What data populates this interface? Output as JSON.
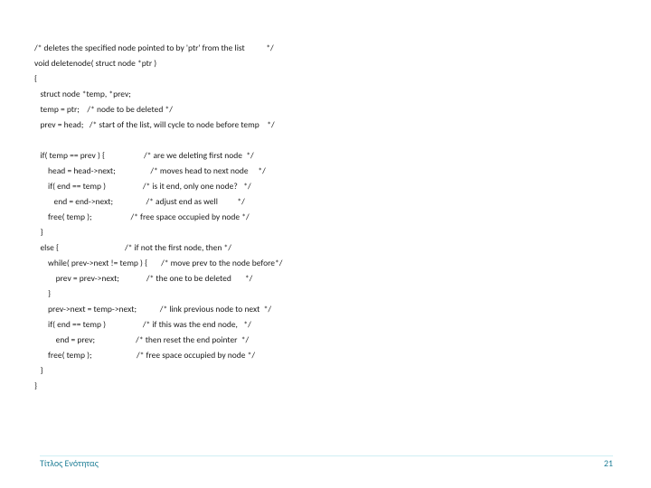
{
  "code": {
    "l1": "/* deletes the specified node pointed to by 'ptr' from the list           */",
    "l2": "void deletenode( struct node *ptr )",
    "l3": "{",
    "l4": "   struct node *temp, *prev;",
    "l5": "   temp = ptr;    /* node to be deleted */",
    "l6": "   prev = head;   /* start of the list, will cycle to node before temp    */",
    "l7": "",
    "l8": "   if( temp == prev ) {                    /* are we deleting first node  */",
    "l9": "       head = head->next;                  /* moves head to next node     */",
    "l10": "       if( end == temp )                   /* is it end, only one node?   */",
    "l11": "          end = end->next;                 /* adjust end as well          */",
    "l12": "       free( temp );                    /* free space occupied by node */",
    "l13": "   }",
    "l14": "   else {                                  /* if not the first node, then */",
    "l15": "       while( prev->next != temp ) {       /* move prev to the node before*/",
    "l16": "           prev = prev->next;              /* the one to be deleted       */",
    "l17": "       }",
    "l18": "       prev->next = temp->next;            /* link previous node to next  */",
    "l19": "       if( end == temp )                   /* if this was the end node,   */",
    "l20": "           end = prev;                     /* then reset the end pointer  */",
    "l21": "       free( temp );                       /* free space occupied by node */",
    "l22": "   }",
    "l23": "}"
  },
  "footer": {
    "title": "Τίτλος Ενότητας",
    "page": "21"
  }
}
